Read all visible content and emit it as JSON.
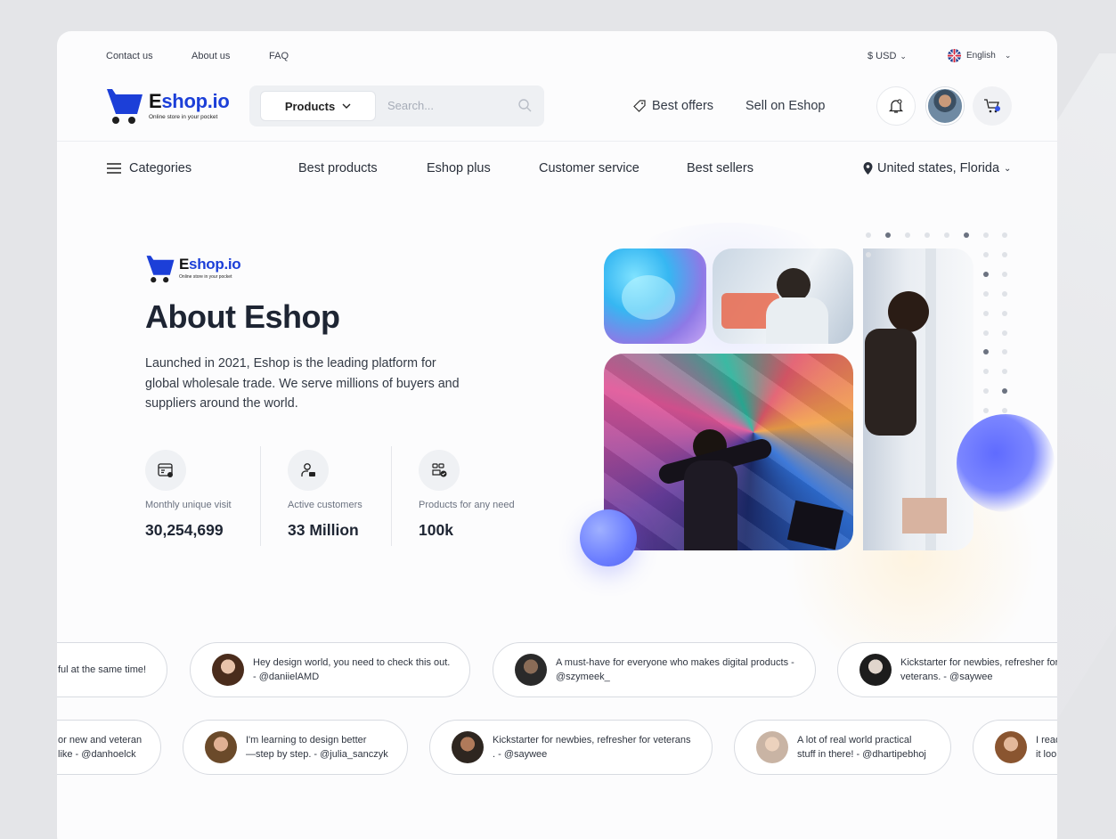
{
  "topbar": {
    "links": [
      "Contact us",
      "About us",
      "FAQ"
    ],
    "currency": "$ USD",
    "language": "English"
  },
  "brand": {
    "name_first": "E",
    "name_rest": "shop.io",
    "tagline": "Online store in your pocket",
    "accent": "#1c3fd8"
  },
  "search": {
    "category": "Products",
    "placeholder": "Search..."
  },
  "header": {
    "best_offers": "Best offers",
    "sell": "Sell on Eshop"
  },
  "nav": {
    "categories": "Categories",
    "items": [
      "Best products",
      "Eshop plus",
      "Customer service",
      "Best sellers"
    ],
    "location": "United states, Florida"
  },
  "about": {
    "title": "About Eshop",
    "desc": "Launched in 2021, Eshop is the leading platform for global wholesale trade. We serve millions of buyers and suppliers around the world.",
    "stats": [
      {
        "label": "Monthly unique visit",
        "value": "30,254,699"
      },
      {
        "label": "Active customers",
        "value": "33 Million"
      },
      {
        "label": "Products for any need",
        "value": "100k"
      }
    ]
  },
  "testimonials": {
    "row1": [
      "ful at the same time!",
      "Hey design world, you need to check this out.\n- @daniielAMD",
      "A must-have for everyone who makes digital products -\n@szymeek_",
      "Kickstarter for newbies, refresher for\nveterans. - @saywee"
    ],
    "row2": [
      "or new and veteran\nlike - @danhoelck",
      "I'm learning to design better\n—step by step. - @julia_sanczyk",
      "Kickstarter for newbies, refresher for veterans\n. - @saywee",
      "A lot of real world practical\nstuff in there! - @dhartipebhoj",
      "I read\nit loo"
    ]
  }
}
